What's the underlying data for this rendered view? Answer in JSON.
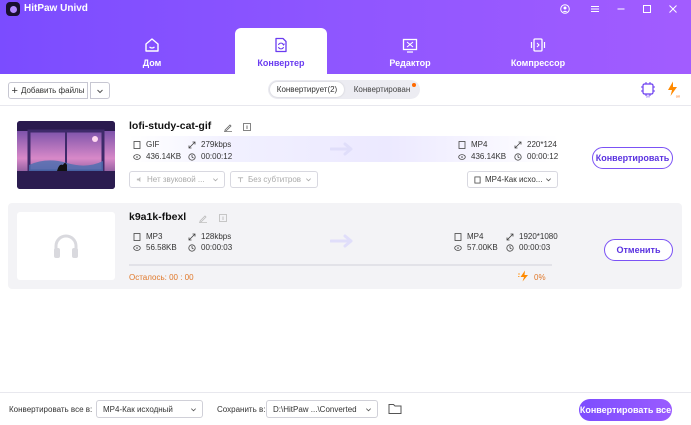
{
  "app": {
    "title": "HitPaw Univd"
  },
  "tabs": [
    {
      "label": "Дом",
      "icon": "home-icon",
      "active": false
    },
    {
      "label": "Конвертер",
      "icon": "converter-icon",
      "active": true
    },
    {
      "label": "Редактор",
      "icon": "editor-icon",
      "active": false
    },
    {
      "label": "Компрессор",
      "icon": "compressor-icon",
      "active": false
    }
  ],
  "toolbar": {
    "add_files": "Добавить файлы",
    "seg_converting": "Конвертирует(2)",
    "seg_converted": "Конвертирован"
  },
  "files": [
    {
      "name": "lofi-study-cat-gif",
      "src": {
        "format": "GIF",
        "bitrate": "279kbps",
        "size": "436.14KB",
        "duration": "00:00:12"
      },
      "dst": {
        "format": "MP4",
        "resolution": "220*124",
        "size": "436.14KB",
        "duration": "00:00:12"
      },
      "audio": "Нет звуковой ...",
      "subtitle": "Без субтитров",
      "output_format": "MP4-Как исхо...",
      "action": "Конвертировать"
    },
    {
      "name": "k9a1k-fbexl",
      "src": {
        "format": "MP3",
        "bitrate": "128kbps",
        "size": "56.58KB",
        "duration": "00:00:03"
      },
      "dst": {
        "format": "MP4",
        "resolution": "1920*1080",
        "size": "57.00KB",
        "duration": "00:00:03"
      },
      "remaining": "Осталось: 00 : 00",
      "progress_text": "0%",
      "progress": 0,
      "action": "Отменить"
    }
  ],
  "footer": {
    "convert_all_label": "Конвертировать все в:",
    "convert_all_value": "MP4-Как исходный",
    "save_label": "Сохранить в:",
    "save_path": "D:\\HitPaw ...\\Converted",
    "convert_all_button": "Конвертировать все"
  },
  "colors": {
    "accent": "#7b4cff",
    "warning": "#e0782a"
  }
}
